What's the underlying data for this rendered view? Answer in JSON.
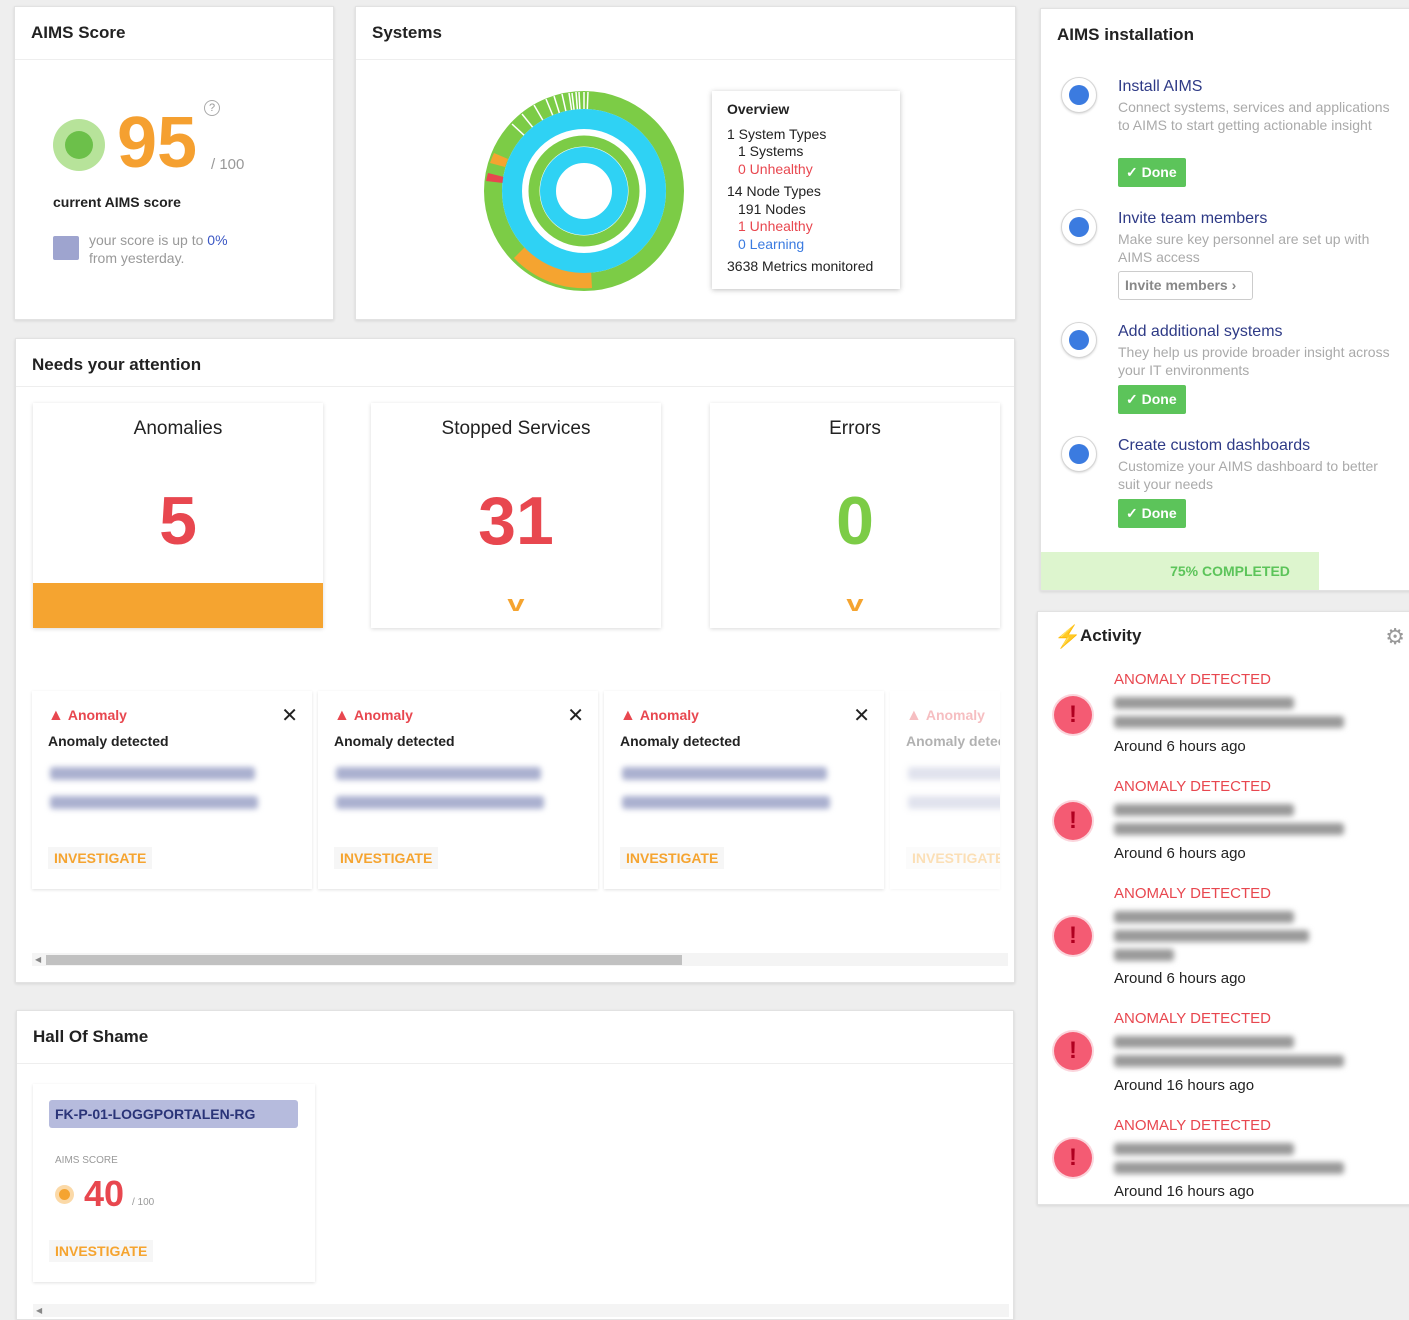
{
  "score": {
    "title": "AIMS Score",
    "value": "95",
    "max": "/ 100",
    "help": "?",
    "caption": "current AIMS score",
    "trend_prefix": "your score is up to ",
    "trend_value": "0%",
    "trend_suffix": "from yesterday."
  },
  "systems": {
    "title": "Systems",
    "overview": {
      "heading": "Overview",
      "system_types": "1 System Types",
      "systems": "1 Systems",
      "systems_unhealthy": "0 Unhealthy",
      "node_types": "14 Node Types",
      "nodes": "191 Nodes",
      "nodes_unhealthy": "1 Unhealthy",
      "nodes_learning": "0 Learning",
      "metrics": "3638 Metrics monitored"
    },
    "colors": {
      "healthy": "#7ccc46",
      "learning": "#2fd2f4",
      "warning": "#f5a430",
      "unhealthy": "#e8474f"
    }
  },
  "attention": {
    "title": "Needs your attention",
    "tiles": [
      {
        "label": "Anomalies",
        "value": "5",
        "color": "#e8474f"
      },
      {
        "label": "Stopped Services",
        "value": "31",
        "color": "#e8474f",
        "chevron": "v"
      },
      {
        "label": "Errors",
        "value": "0",
        "color": "#7ccc46",
        "chevron": "v"
      }
    ],
    "anomalies": [
      {
        "type": "Anomaly",
        "subtitle": "Anomaly detected",
        "action": "INVESTIGATE",
        "close": "✕"
      },
      {
        "type": "Anomaly",
        "subtitle": "Anomaly detected",
        "action": "INVESTIGATE",
        "close": "✕"
      },
      {
        "type": "Anomaly",
        "subtitle": "Anomaly detected",
        "action": "INVESTIGATE",
        "close": "✕"
      },
      {
        "type": "Anomaly",
        "subtitle": "Anomaly detected",
        "action": "INVESTIGATE"
      }
    ]
  },
  "shame": {
    "title": "Hall Of Shame",
    "item": {
      "name": "FK-P-01-LOGGPORTALEN-RG",
      "label": "AIMS SCORE",
      "value": "40",
      "max": "/ 100",
      "action": "INVESTIGATE"
    }
  },
  "install": {
    "title": "AIMS installation",
    "steps": [
      {
        "title": "Install AIMS",
        "desc": "Connect systems, services and applications to AIMS to start getting actionable insight",
        "button": "✓ Done"
      },
      {
        "title": "Invite team members",
        "desc": "Make sure key personnel are set up with AIMS access",
        "button": "Invite members ›"
      },
      {
        "title": "Add additional systems",
        "desc": "They help us provide broader insight across your IT environments",
        "button": "✓ Done"
      },
      {
        "title": "Create custom dashboards",
        "desc": "Customize your AIMS dashboard to better suit your needs",
        "button": "✓ Done"
      }
    ],
    "progress_text": "75% COMPLETED",
    "progress": 0.75
  },
  "activity": {
    "title": "Activity",
    "items": [
      {
        "type": "ANOMALY DETECTED",
        "time": "Around 6 hours ago"
      },
      {
        "type": "ANOMALY DETECTED",
        "time": "Around 6 hours ago"
      },
      {
        "type": "ANOMALY DETECTED",
        "time": "Around 6 hours ago"
      },
      {
        "type": "ANOMALY DETECTED",
        "time": "Around 16 hours ago"
      },
      {
        "type": "ANOMALY DETECTED",
        "time": "Around 16 hours ago"
      }
    ]
  }
}
